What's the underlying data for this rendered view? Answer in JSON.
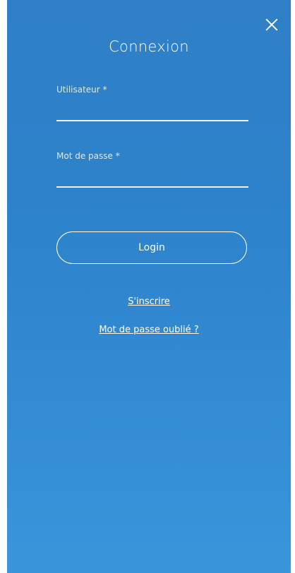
{
  "header": {
    "title": "Connexion",
    "close_icon": "close-icon"
  },
  "form": {
    "username_label": "Utilisateur *",
    "username_value": "",
    "password_label": "Mot de passe *",
    "password_value": "",
    "login_label": "Login"
  },
  "links": {
    "register": "S'inscrire",
    "forgot_password": "Mot de passe oublié ?"
  },
  "colors": {
    "background_top": "#2f7fc6",
    "background_bottom": "#3a95db",
    "foreground": "#ffffff"
  }
}
